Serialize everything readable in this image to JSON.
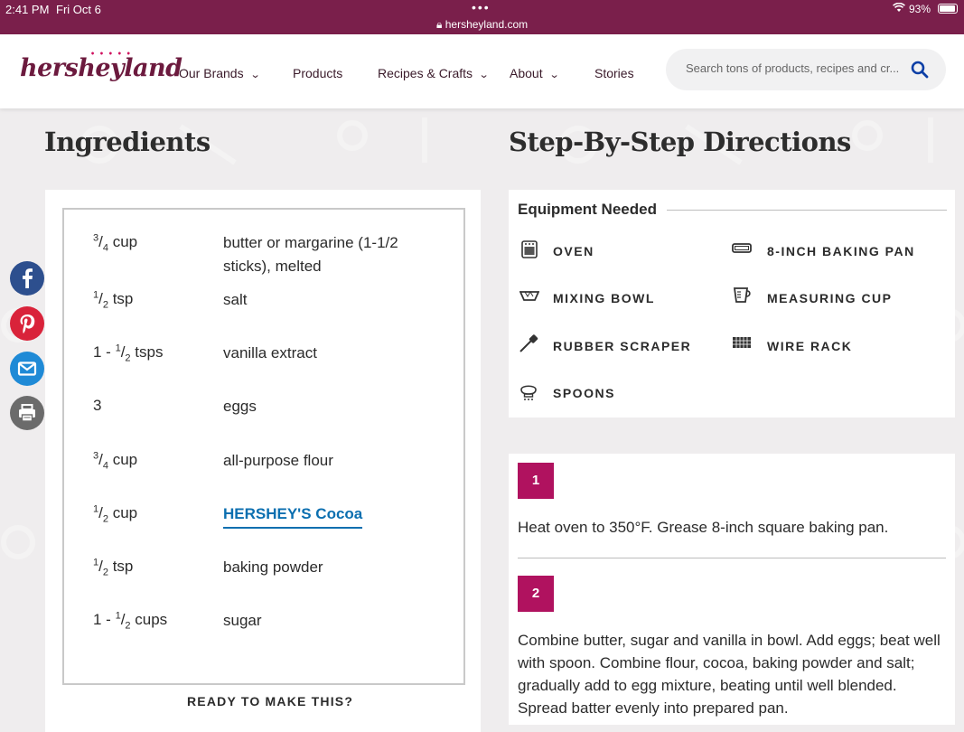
{
  "status_bar": {
    "time": "2:41 PM",
    "date": "Fri Oct 6",
    "url": "hersheyland.com",
    "battery": "93%"
  },
  "brand": {
    "logo_text": "hersheyland",
    "accent": "#b0125f",
    "maroon": "#7a1f4b",
    "link": "#0b6fb0"
  },
  "nav": {
    "items": [
      {
        "label": "Our Brands",
        "has_dropdown": true
      },
      {
        "label": "Products",
        "has_dropdown": false
      },
      {
        "label": "Recipes & Crafts",
        "has_dropdown": true
      },
      {
        "label": "About",
        "has_dropdown": true
      },
      {
        "label": "Stories",
        "has_dropdown": false
      }
    ],
    "search_placeholder": "Search tons of products, recipes and cr..."
  },
  "ingredients": {
    "heading": "Ingredients",
    "items": [
      {
        "qty_whole": "",
        "qty_num": "3",
        "qty_den": "4",
        "qty_unit": " cup",
        "name": "butter or margarine (1-1/2 sticks), melted",
        "is_link": false
      },
      {
        "qty_whole": "",
        "qty_num": "1",
        "qty_den": "2",
        "qty_unit": " tsp",
        "name": "salt",
        "is_link": false
      },
      {
        "qty_whole": "1 - ",
        "qty_num": "1",
        "qty_den": "2",
        "qty_unit": " tsps",
        "name": "vanilla extract",
        "is_link": false
      },
      {
        "qty_whole": "3",
        "qty_num": "",
        "qty_den": "",
        "qty_unit": "",
        "name": "eggs",
        "is_link": false
      },
      {
        "qty_whole": "",
        "qty_num": "3",
        "qty_den": "4",
        "qty_unit": " cup",
        "name": "all-purpose flour",
        "is_link": false
      },
      {
        "qty_whole": "",
        "qty_num": "1",
        "qty_den": "2",
        "qty_unit": " cup",
        "name": "HERSHEY'S Cocoa",
        "is_link": true
      },
      {
        "qty_whole": "",
        "qty_num": "1",
        "qty_den": "2",
        "qty_unit": " tsp",
        "name": "baking powder",
        "is_link": false
      },
      {
        "qty_whole": "1 - ",
        "qty_num": "1",
        "qty_den": "2",
        "qty_unit": " cups",
        "name": "sugar",
        "is_link": false
      }
    ],
    "ready_label": "READY TO MAKE THIS?"
  },
  "share": [
    {
      "name": "facebook",
      "glyph": "f",
      "color": "#2d4f8e"
    },
    {
      "name": "pinterest",
      "glyph": "P",
      "color": "#d9233a"
    },
    {
      "name": "email",
      "glyph": "✉",
      "color": "#1f8ad6"
    },
    {
      "name": "print",
      "glyph": "⎙",
      "color": "#6b6b6b"
    }
  ],
  "directions": {
    "heading": "Step-By-Step Directions",
    "equipment_title": "Equipment Needed",
    "equipment": [
      {
        "label": "OVEN",
        "icon": "oven-icon"
      },
      {
        "label": "8-INCH BAKING PAN",
        "icon": "baking-pan-icon"
      },
      {
        "label": "MIXING BOWL",
        "icon": "mixing-bowl-icon"
      },
      {
        "label": "MEASURING CUP",
        "icon": "measuring-cup-icon"
      },
      {
        "label": "RUBBER SCRAPER",
        "icon": "rubber-scraper-icon"
      },
      {
        "label": "WIRE RACK",
        "icon": "wire-rack-icon"
      },
      {
        "label": "SPOONS",
        "icon": "spoons-icon"
      }
    ],
    "steps": [
      {
        "number": "1",
        "text": "Heat oven to 350°F. Grease 8-inch square baking pan."
      },
      {
        "number": "2",
        "text": "Combine butter, sugar and vanilla in bowl. Add eggs; beat well with spoon. Combine flour, cocoa, baking powder and salt; gradually add to egg mixture, beating until well blended. Spread batter evenly into prepared pan."
      }
    ]
  }
}
